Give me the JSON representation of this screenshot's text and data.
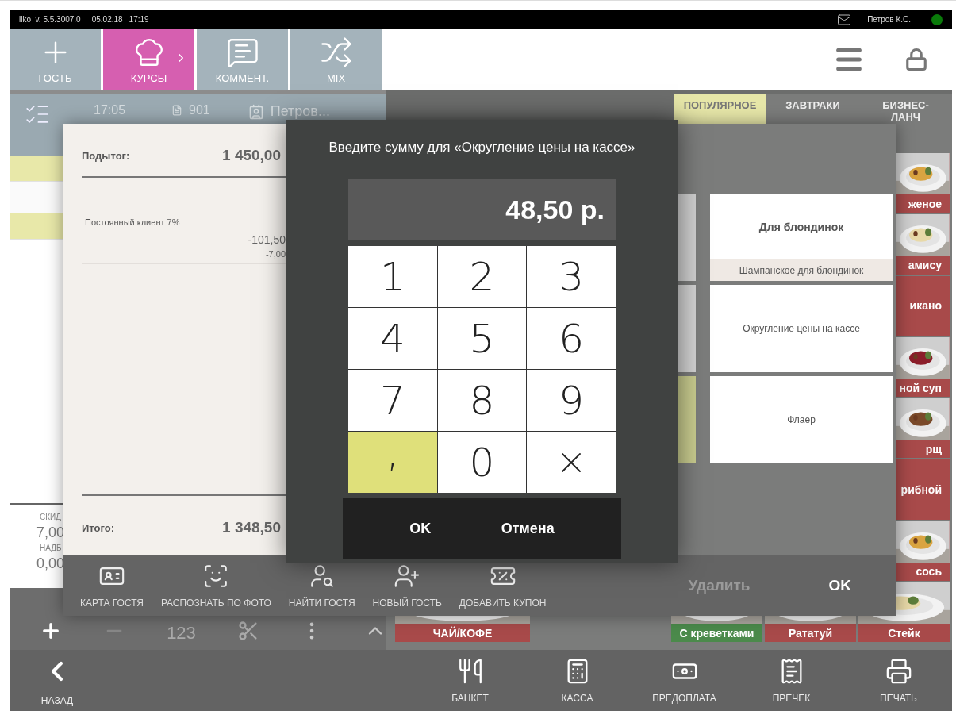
{
  "status_bar": {
    "app": "iiko",
    "version": "v. 5.5.3007.0",
    "date": "05.02.18",
    "time": "17:19",
    "user": "Петров К.С.",
    "online": true
  },
  "toolbar": [
    {
      "label": "ГОСТЬ",
      "kind": "plus",
      "selected": false,
      "submenu": false
    },
    {
      "label": "КУРСЫ",
      "kind": "chef",
      "selected": true,
      "submenu": true
    },
    {
      "label": "КОММЕНТ.",
      "kind": "comment",
      "selected": false,
      "submenu": false
    },
    {
      "label": "MIX",
      "kind": "shuffle",
      "selected": false,
      "submenu": false
    }
  ],
  "order": {
    "time": "17:05",
    "number": "901",
    "waiter": "Петров...",
    "rows": [
      {
        "highlighted": true
      },
      {
        "highlighted": false
      },
      {
        "highlighted": true
      }
    ],
    "summary": [
      {
        "label": "СКИД",
        "value": "7,00"
      },
      {
        "label": "НАДБ",
        "value": "0,00"
      }
    ],
    "tools": [
      {
        "kind": "plus"
      },
      {
        "kind": "minus"
      },
      {
        "kind": "text",
        "label": "123"
      },
      {
        "kind": "scissors"
      },
      {
        "kind": "more"
      },
      {
        "kind": "up"
      }
    ]
  },
  "categories": [
    {
      "label": "ПОПУЛЯРНОЕ",
      "selected": true
    },
    {
      "label": "ЗАВТРАКИ",
      "selected": false
    },
    {
      "label": "БИЗНЕС-ЛАНЧ",
      "selected": false
    }
  ],
  "products_right": [
    {
      "label": "женое",
      "color": "#a84a4a"
    },
    {
      "label": "амису",
      "color": "#a84a4a"
    },
    {
      "label": "икано",
      "kind": "plain",
      "color": "#a84a4a"
    },
    {
      "label": "ной суп",
      "color": "#a84a4a"
    },
    {
      "label": "рщ",
      "color": "#a84a4a"
    },
    {
      "label": "рибной",
      "kind": "plain",
      "color": "#a84a4a"
    },
    {
      "label": "сось",
      "color": "#a84a4a"
    },
    {
      "label": "Стейк",
      "color": "#a84a4a"
    }
  ],
  "products_bottom": [
    {
      "label": "ЧАЙ/КОФЕ",
      "color": "#a84a4a"
    },
    {
      "label": "С креветками",
      "color": "#4b8a4b"
    },
    {
      "label": "Рататуй",
      "color": "#a84a4a"
    }
  ],
  "discount_dialog": {
    "subtotal_label": "Подытог:",
    "subtotal": "1 450,00",
    "total_label": "Итого:",
    "total": "1 348,50",
    "discounts": [
      {
        "name": "Постоянный клиент 7%",
        "amount": "-101,50",
        "percent": "-7,00"
      }
    ],
    "option_stubs": [
      {
        "color": "#cfcfcf"
      },
      {
        "color": "#d2d2d2"
      },
      {
        "color": "#c8cb8e"
      }
    ],
    "options": [
      {
        "title": "Для блондинок",
        "subtitle": "Шампанское для блондинок"
      },
      {
        "title": "Округление цены на кассе"
      },
      {
        "title": "Флаер"
      }
    ],
    "guest_actions": [
      {
        "label": "КАРТА ГОСТЯ",
        "kind": "card"
      },
      {
        "label": "РАСПОЗНАТЬ ПО ФОТО",
        "kind": "face"
      },
      {
        "label": "НАЙТИ ГОСТЯ",
        "kind": "find"
      },
      {
        "label": "НОВЫЙ ГОСТЬ",
        "kind": "new"
      },
      {
        "label": "ДОБАВИТЬ КУПОН",
        "kind": "coupon"
      }
    ],
    "delete": {
      "label": "Удалить",
      "disabled": true
    },
    "ok": "OK"
  },
  "amount_dialog": {
    "title": "Введите сумму для «Округление цены на кассе»",
    "value": "48,50 р.",
    "keys": [
      {
        "kind": "digit",
        "label": "1"
      },
      {
        "kind": "digit",
        "label": "2"
      },
      {
        "kind": "digit",
        "label": "3"
      },
      {
        "kind": "digit",
        "label": "4"
      },
      {
        "kind": "digit",
        "label": "5"
      },
      {
        "kind": "digit",
        "label": "6"
      },
      {
        "kind": "digit",
        "label": "7"
      },
      {
        "kind": "digit",
        "label": "8"
      },
      {
        "kind": "digit",
        "label": "9"
      },
      {
        "kind": "accent",
        "label": ","
      },
      {
        "kind": "digit",
        "label": "0"
      },
      {
        "kind": "clear"
      }
    ],
    "buttons": [
      "OK",
      "Отмена"
    ]
  },
  "nav": {
    "back": "НАЗАД",
    "actions": [
      {
        "label": "БАНКЕТ",
        "kind": "banquet"
      },
      {
        "label": "КАССА",
        "kind": "cash"
      },
      {
        "label": "ПРЕДОПЛАТА",
        "kind": "prepay"
      },
      {
        "label": "ПРЕЧЕК",
        "kind": "precheck"
      },
      {
        "label": "ПЕЧАТЬ",
        "kind": "print"
      }
    ]
  }
}
